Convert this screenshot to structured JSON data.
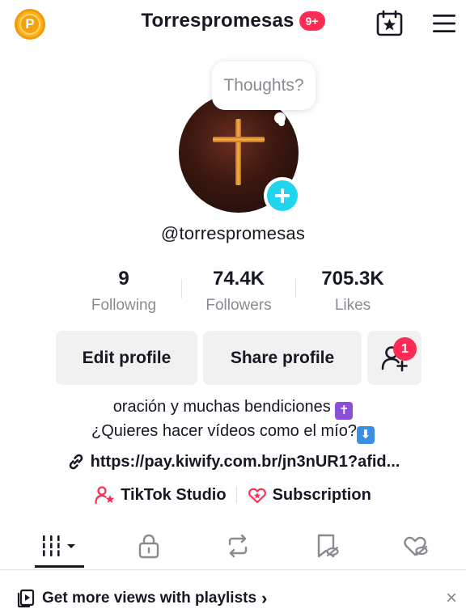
{
  "header": {
    "coin_letter": "P",
    "username_title": "Torrespromesas",
    "notification_badge": "9+"
  },
  "profile": {
    "thoughts_placeholder": "Thoughts?",
    "handle": "@torrespromesas"
  },
  "stats": [
    {
      "value": "9",
      "label": "Following"
    },
    {
      "value": "74.4K",
      "label": "Followers"
    },
    {
      "value": "705.3K",
      "label": "Likes"
    }
  ],
  "actions": {
    "edit_label": "Edit profile",
    "share_label": "Share profile",
    "friend_requests_count": "1"
  },
  "bio": {
    "line1": "oración y muchas bendiciones",
    "line1_emoji": "✝",
    "line2": "¿Quieres hacer vídeos como el mío?",
    "line2_emoji": "⬇"
  },
  "link": {
    "url": "https://pay.kiwify.com.br/jn3nUR1?afid..."
  },
  "tools": {
    "studio_label": "TikTok Studio",
    "subscription_label": "Subscription"
  },
  "tabs": [
    "videos-grid",
    "private",
    "reposts",
    "favorites",
    "liked"
  ],
  "banner": {
    "text": "Get more views with playlists",
    "chevron": "›",
    "close": "×"
  },
  "colors": {
    "accent_red": "#fe2c55",
    "accent_cyan": "#20d5ec",
    "text_primary": "#161823",
    "text_secondary": "#8a8b91",
    "button_bg": "#f1f1f2"
  }
}
